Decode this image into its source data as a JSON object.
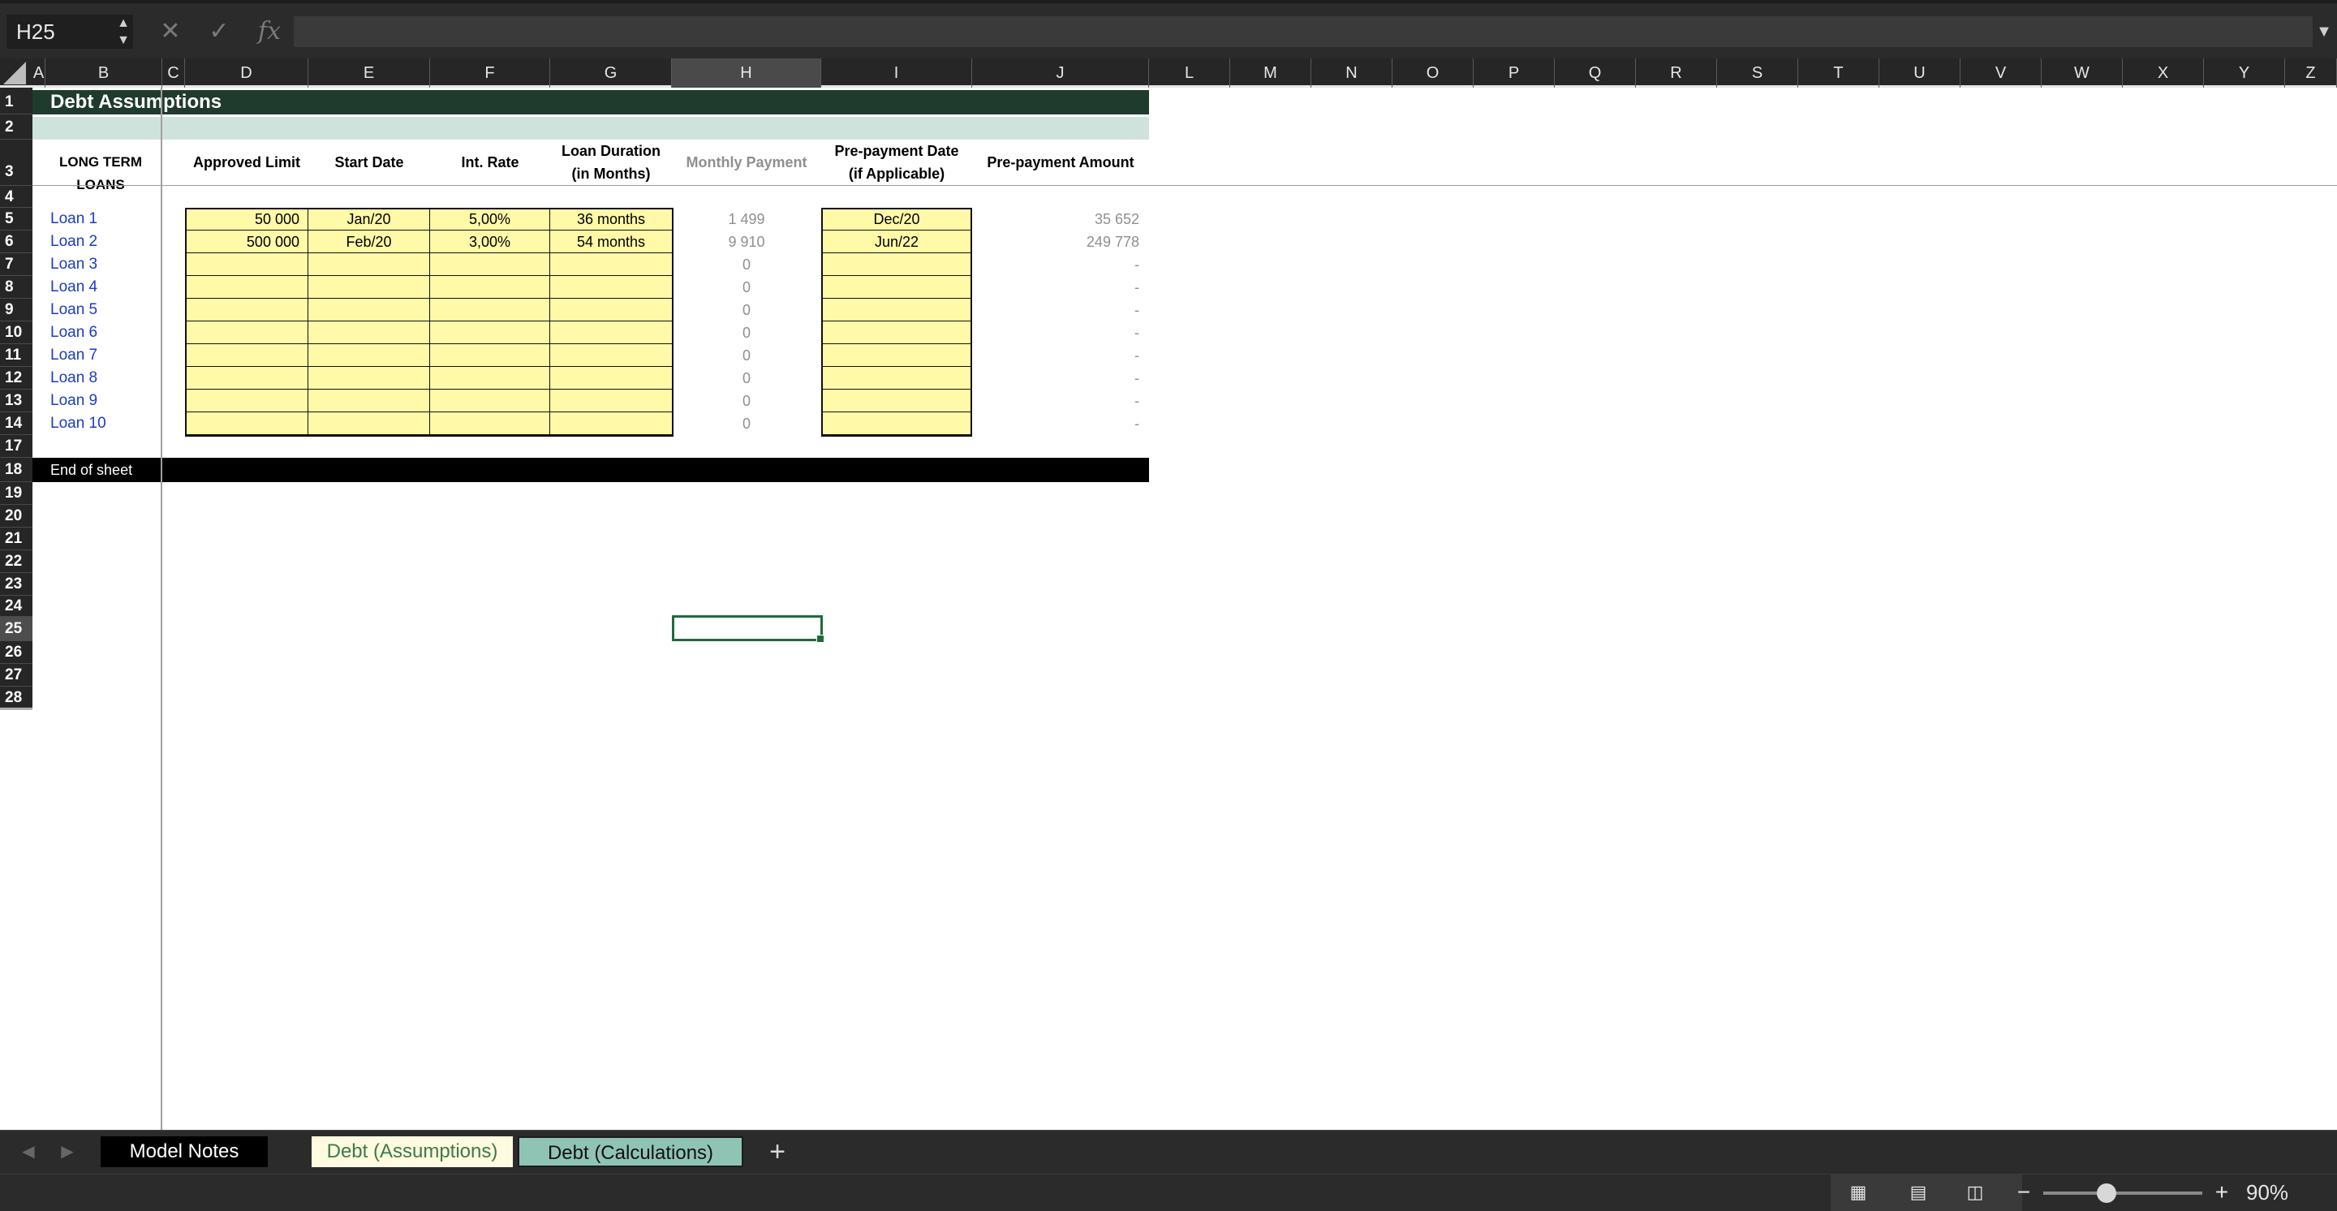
{
  "formula_bar": {
    "cell_ref": "H25",
    "formula": "",
    "cancel_icon": "x-icon",
    "confirm_icon": "check-icon",
    "fx_label": "fx"
  },
  "columns": [
    "A",
    "B",
    "C",
    "D",
    "E",
    "F",
    "G",
    "H",
    "I",
    "J",
    "L",
    "M",
    "N",
    "O",
    "P",
    "Q",
    "R",
    "S",
    "T",
    "U",
    "V",
    "W",
    "X",
    "Y",
    "Z"
  ],
  "selected_column": "H",
  "rows": [
    "1",
    "2",
    "3",
    "4",
    "5",
    "6",
    "7",
    "8",
    "9",
    "10",
    "11",
    "12",
    "13",
    "14",
    "17",
    "18",
    "19",
    "20",
    "21",
    "22",
    "23",
    "24",
    "25",
    "26",
    "27",
    "28"
  ],
  "selected_row": "25",
  "sheet": {
    "title": "Debt Assumptions",
    "headers": {
      "b": "LONG TERM LOANS",
      "d": "Approved Limit",
      "e": "Start Date",
      "f": "Int. Rate",
      "g1": "Loan Duration",
      "g2": "(in Months)",
      "h": "Monthly Payment",
      "i1": "Pre-payment Date",
      "i2": "(if Applicable)",
      "j": "Pre-payment Amount"
    },
    "loans": [
      {
        "name": "Loan 1",
        "limit": "50 000",
        "start": "Jan/20",
        "rate": "5,00%",
        "duration": "36 months",
        "monthly": "1 499",
        "pre_date": "Dec/20",
        "pre_amount": "35 652"
      },
      {
        "name": "Loan 2",
        "limit": "500 000",
        "start": "Feb/20",
        "rate": "3,00%",
        "duration": "54 months",
        "monthly": "9 910",
        "pre_date": "Jun/22",
        "pre_amount": "249 778"
      },
      {
        "name": "Loan 3",
        "limit": "",
        "start": "",
        "rate": "",
        "duration": "",
        "monthly": "0",
        "pre_date": "",
        "pre_amount": "-"
      },
      {
        "name": "Loan 4",
        "limit": "",
        "start": "",
        "rate": "",
        "duration": "",
        "monthly": "0",
        "pre_date": "",
        "pre_amount": "-"
      },
      {
        "name": "Loan 5",
        "limit": "",
        "start": "",
        "rate": "",
        "duration": "",
        "monthly": "0",
        "pre_date": "",
        "pre_amount": "-"
      },
      {
        "name": "Loan 6",
        "limit": "",
        "start": "",
        "rate": "",
        "duration": "",
        "monthly": "0",
        "pre_date": "",
        "pre_amount": "-"
      },
      {
        "name": "Loan 7",
        "limit": "",
        "start": "",
        "rate": "",
        "duration": "",
        "monthly": "0",
        "pre_date": "",
        "pre_amount": "-"
      },
      {
        "name": "Loan 8",
        "limit": "",
        "start": "",
        "rate": "",
        "duration": "",
        "monthly": "0",
        "pre_date": "",
        "pre_amount": "-"
      },
      {
        "name": "Loan 9",
        "limit": "",
        "start": "",
        "rate": "",
        "duration": "",
        "monthly": "0",
        "pre_date": "",
        "pre_amount": "-"
      },
      {
        "name": "Loan 10",
        "limit": "",
        "start": "",
        "rate": "",
        "duration": "",
        "monthly": "0",
        "pre_date": "",
        "pre_amount": "-"
      }
    ],
    "end_label": "End of sheet"
  },
  "tabs": [
    {
      "label": "Model Notes",
      "bg": "#000000",
      "color": "#ffffff"
    },
    {
      "label": "Debt (Assumptions)",
      "bg": "#fffbe0",
      "color": "#3c7a45"
    },
    {
      "label": "Debt (Calculations)",
      "bg": "#8fc4b4",
      "color": "#111111"
    }
  ],
  "add_sheet": "+",
  "status": {
    "zoom": "90%",
    "zoom_fraction": 0.4,
    "views": [
      "normal-view-icon",
      "page-layout-icon",
      "page-break-icon"
    ]
  }
}
